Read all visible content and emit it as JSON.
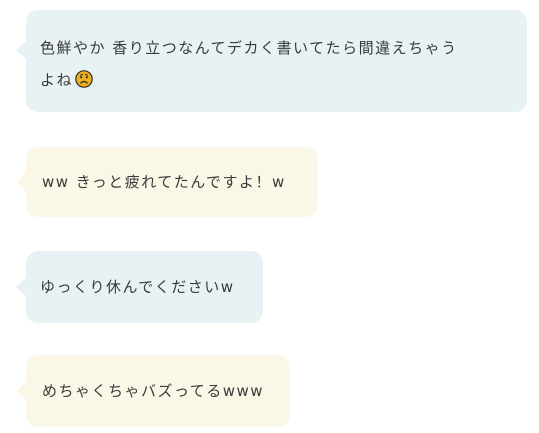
{
  "messages": [
    {
      "text_line1": "色鮮やか 香り立つなんてデカく書いてたら間違えちゃう",
      "text_line2": "よね",
      "emoji": "confused-face-icon",
      "color": "#e8f2f4"
    },
    {
      "text": "ww きっと疲れてたんですよ！w",
      "color": "#fbf7e6"
    },
    {
      "text": "ゆっくり休んでくださいw",
      "color": "#e8f2f4"
    },
    {
      "text": "めちゃくちゃバズってるwww",
      "color": "#fbf7e6"
    }
  ]
}
